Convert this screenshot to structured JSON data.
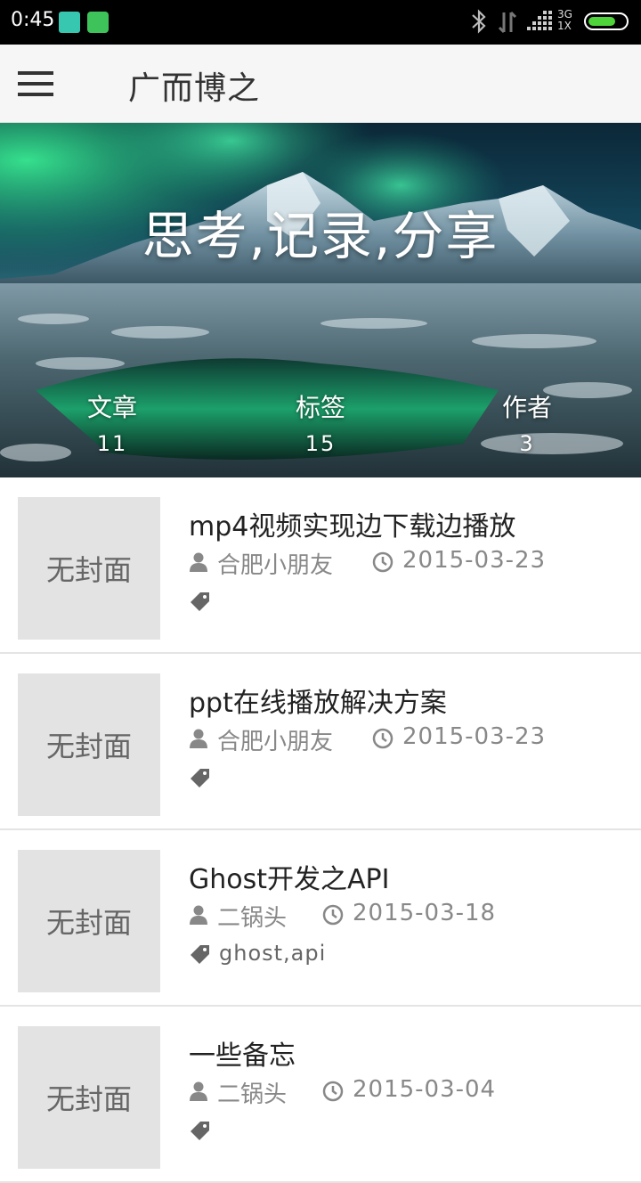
{
  "status_bar": {
    "time": "0:45",
    "network_top": "3G",
    "network_bottom": "1X"
  },
  "toolbar": {
    "title": "广而博之"
  },
  "hero": {
    "slogan": "思考,记录,分享",
    "stats": [
      {
        "label": "文章",
        "value": "11"
      },
      {
        "label": "标签",
        "value": "15"
      },
      {
        "label": "作者",
        "value": "3"
      }
    ]
  },
  "posts": [
    {
      "cover_text": "无封面",
      "title": "mp4视频实现边下载边播放",
      "author": "合肥小朋友",
      "date": "2015-03-23",
      "tags": ""
    },
    {
      "cover_text": "无封面",
      "title": "ppt在线播放解决方案",
      "author": "合肥小朋友",
      "date": "2015-03-23",
      "tags": ""
    },
    {
      "cover_text": "无封面",
      "title": "Ghost开发之API",
      "author": "二锅头",
      "date": "2015-03-18",
      "tags": "ghost,api"
    },
    {
      "cover_text": "无封面",
      "title": "一些备忘",
      "author": "二锅头",
      "date": "2015-03-04",
      "tags": ""
    }
  ]
}
